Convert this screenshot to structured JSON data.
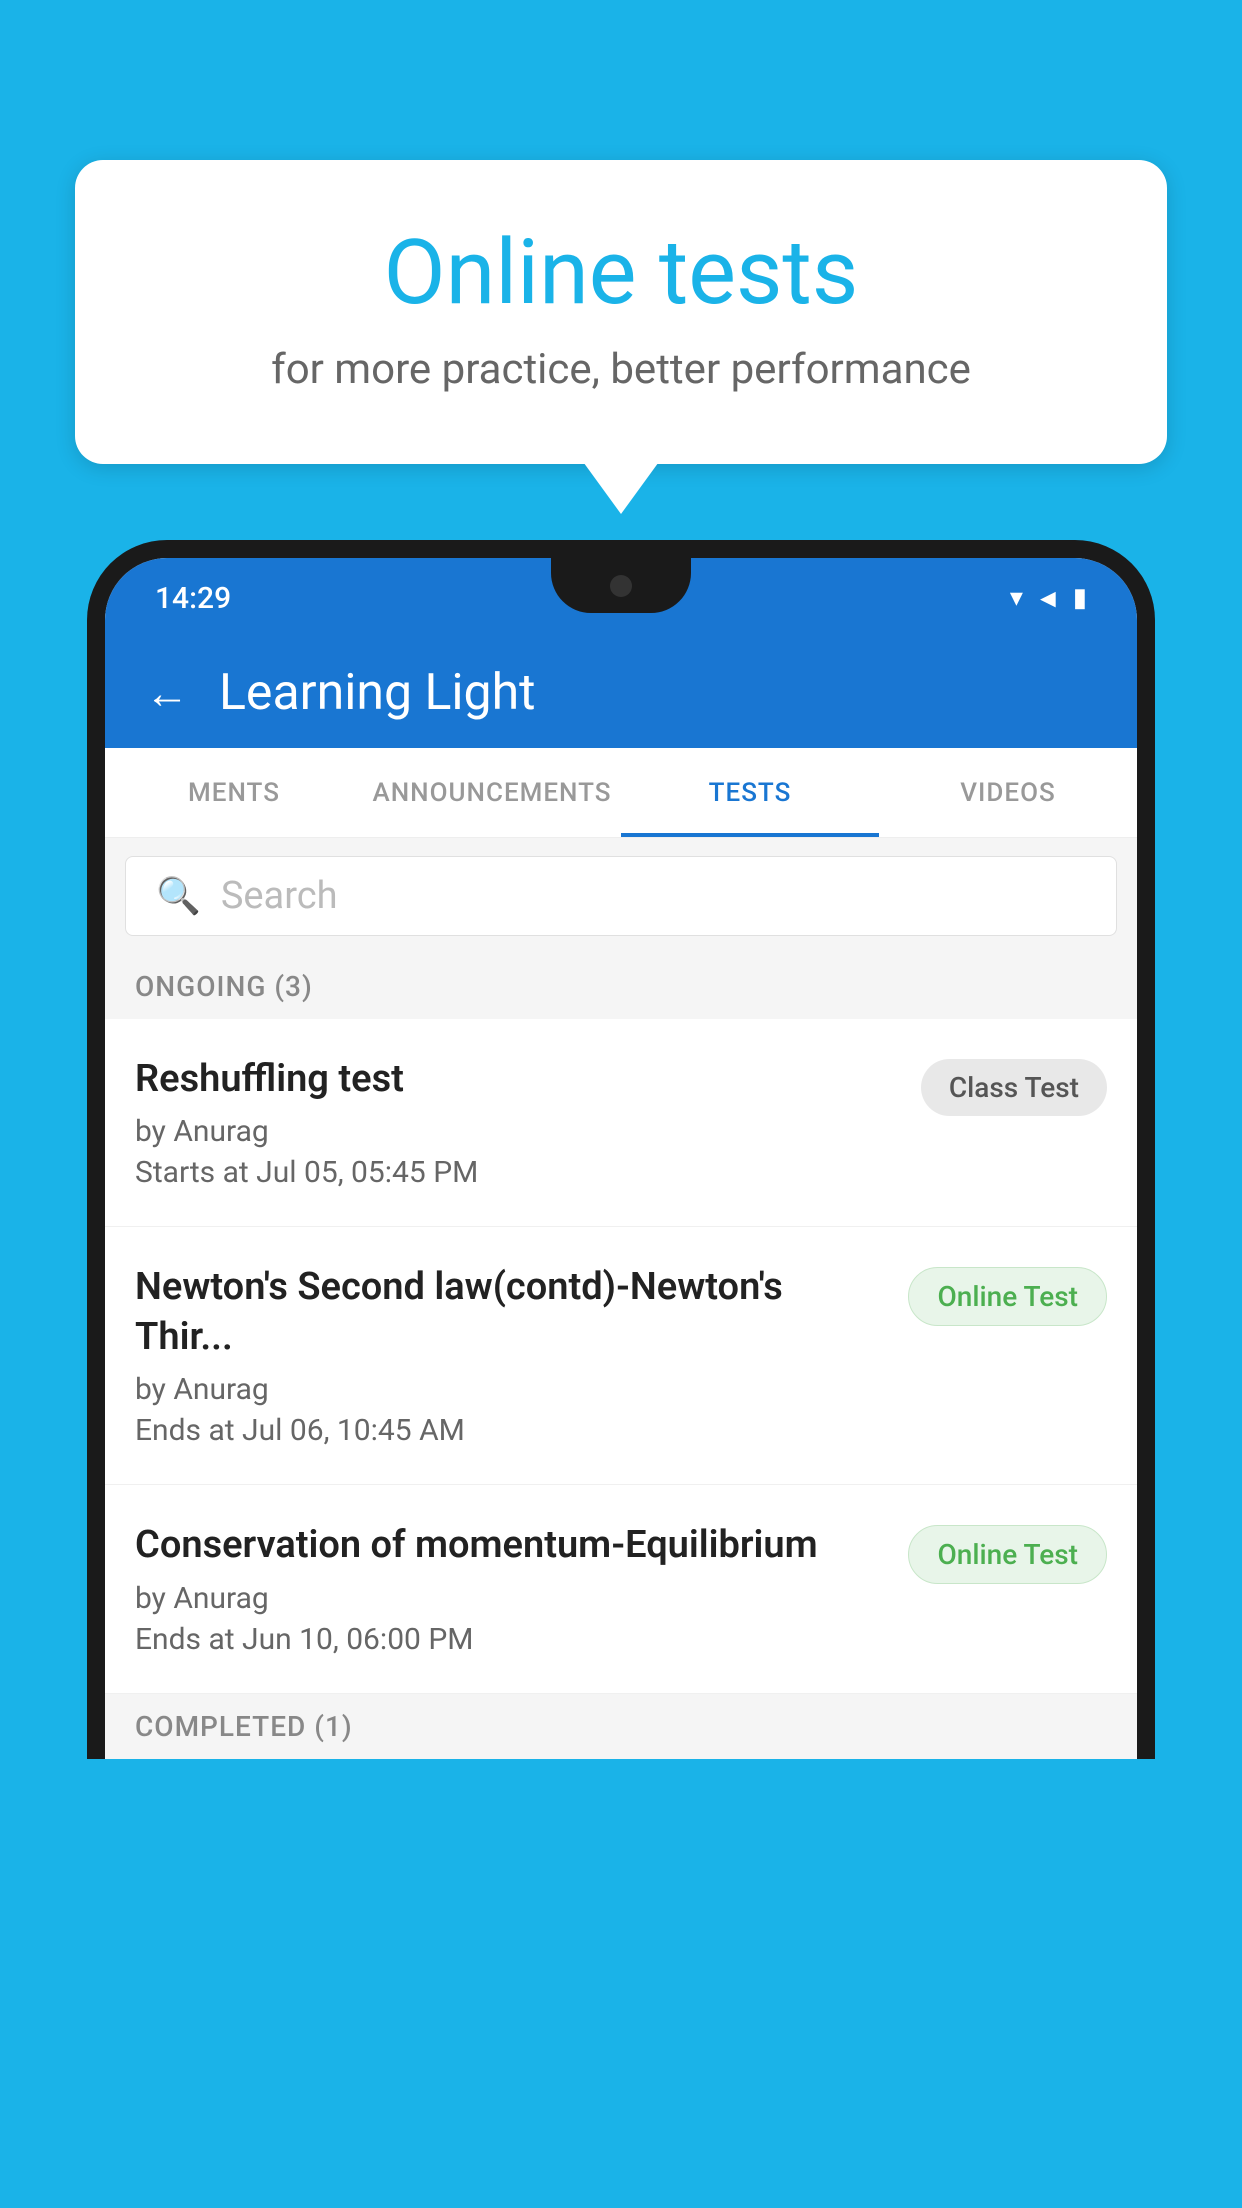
{
  "background_color": "#1ab3e8",
  "speech_bubble": {
    "title": "Online tests",
    "subtitle": "for more practice, better performance"
  },
  "phone": {
    "status_bar": {
      "time": "14:29",
      "icons": [
        "wifi",
        "signal",
        "battery"
      ]
    },
    "app_header": {
      "back_label": "←",
      "title": "Learning Light"
    },
    "tabs": [
      {
        "label": "MENTS",
        "active": false
      },
      {
        "label": "ANNOUNCEMENTS",
        "active": false
      },
      {
        "label": "TESTS",
        "active": true
      },
      {
        "label": "VIDEOS",
        "active": false
      }
    ],
    "search": {
      "placeholder": "Search"
    },
    "sections": [
      {
        "header": "ONGOING (3)",
        "tests": [
          {
            "name": "Reshuffling test",
            "author": "by Anurag",
            "time": "Starts at  Jul 05, 05:45 PM",
            "badge": "Class Test",
            "badge_type": "class"
          },
          {
            "name": "Newton's Second law(contd)-Newton's Thir...",
            "author": "by Anurag",
            "time": "Ends at  Jul 06, 10:45 AM",
            "badge": "Online Test",
            "badge_type": "online"
          },
          {
            "name": "Conservation of momentum-Equilibrium",
            "author": "by Anurag",
            "time": "Ends at  Jun 10, 06:00 PM",
            "badge": "Online Test",
            "badge_type": "online"
          }
        ]
      }
    ],
    "completed_header": "COMPLETED (1)"
  }
}
